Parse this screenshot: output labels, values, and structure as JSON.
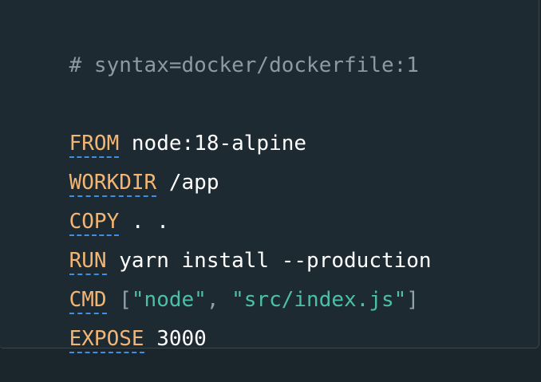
{
  "code": {
    "comment": "# syntax=docker/dockerfile:1",
    "lines": [
      {
        "keyword": "FROM",
        "arg": " node:18-alpine"
      },
      {
        "keyword": "WORKDIR",
        "arg": " /app"
      },
      {
        "keyword": "COPY",
        "arg": " . ."
      },
      {
        "keyword": "RUN",
        "arg": " yarn install --production"
      },
      {
        "keyword": "CMD",
        "open": " [",
        "str1": "\"node\"",
        "sep": ", ",
        "str2": "\"src/index.js\"",
        "close": "]"
      },
      {
        "keyword": "EXPOSE",
        "arg": " 3000"
      }
    ]
  },
  "colors": {
    "background": "#1e2a31",
    "comment": "#8d9aa3",
    "keyword": "#f2b574",
    "keyword_underline": "#3f8fe5",
    "string": "#4bc0a8",
    "punctuation": "#8fa1ad",
    "text": "#ffffff"
  }
}
